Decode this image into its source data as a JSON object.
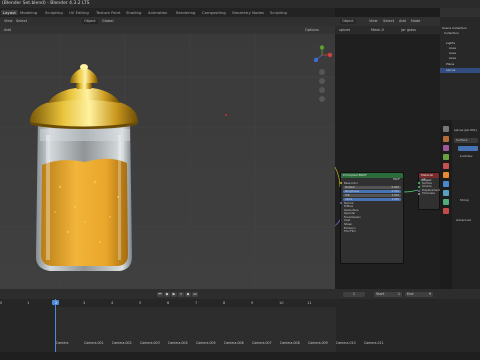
{
  "window": {
    "title": "(Blender Set.blend) - Blender 4.3.2 LTS"
  },
  "workspaces": [
    "Layout",
    "Modeling",
    "Sculpting",
    "UV Editing",
    "Texture Paint",
    "Shading",
    "Animation",
    "Rendering",
    "Compositing",
    "Geometry Nodes",
    "Scripting"
  ],
  "viewport": {
    "mode": "Object",
    "view_menu": "View",
    "select_menu": "Select",
    "add_menu": "Add",
    "object_menu": "Object",
    "global_label": "Global",
    "options_label": "Options",
    "render_label": "User Pers."
  },
  "node_editor": {
    "mode": "Object",
    "menus": [
      "View",
      "Select",
      "Add",
      "Node"
    ],
    "breadcrumbs": [
      "spices",
      "Mesh.0",
      "jar glass"
    ],
    "bsdf_node": {
      "title": "Principled BSDF",
      "rows": [
        "BSDF",
        "Base Color",
        "Metallic",
        "Roughness",
        "IOR",
        "Alpha",
        "Normal",
        "Diffuse",
        "Subsurface",
        "Specular",
        "Transmission",
        "Coat",
        "Sheen",
        "Emission",
        "Thin Film"
      ],
      "values": {
        "metallic": "0.000",
        "roughness": "0.500",
        "ior": "1.500",
        "alpha": "1.000"
      }
    },
    "output_node": {
      "title": "Material Output",
      "rows": [
        "All",
        "Surface",
        "Volume",
        "Displacement",
        "Thickness"
      ]
    }
  },
  "outliner": {
    "items": [
      "Scene Collection",
      "Collection",
      "Lights",
      "Area",
      "Area",
      "Area",
      "Plane",
      "spices"
    ]
  },
  "properties": {
    "object_name": "spices (Jar.001)",
    "labels": [
      "Surface",
      "Lookdev",
      "Shrop",
      "Advanced"
    ]
  },
  "timeline": {
    "frames": [
      "0",
      "1",
      "2",
      "3",
      "4",
      "5",
      "6",
      "7",
      "8",
      "9",
      "10",
      "11"
    ],
    "current_frame": "1",
    "start_label": "Start",
    "start": "1",
    "end_label": "End",
    "end": "9",
    "markers": [
      "Camera",
      "Camera.001",
      "Camera.002",
      "Camera.003",
      "Camera.004",
      "Camera.005",
      "Camera.006",
      "Camera.007",
      "Camera.008",
      "Camera.009",
      "Camera.010",
      "Camera.011"
    ]
  },
  "icons": [
    "play-icon",
    "pause-icon",
    "jump-start-icon",
    "jump-end-icon",
    "key-prev-icon",
    "key-next-icon",
    "zoom-icon",
    "hand-icon",
    "camera-icon",
    "grid-icon"
  ]
}
